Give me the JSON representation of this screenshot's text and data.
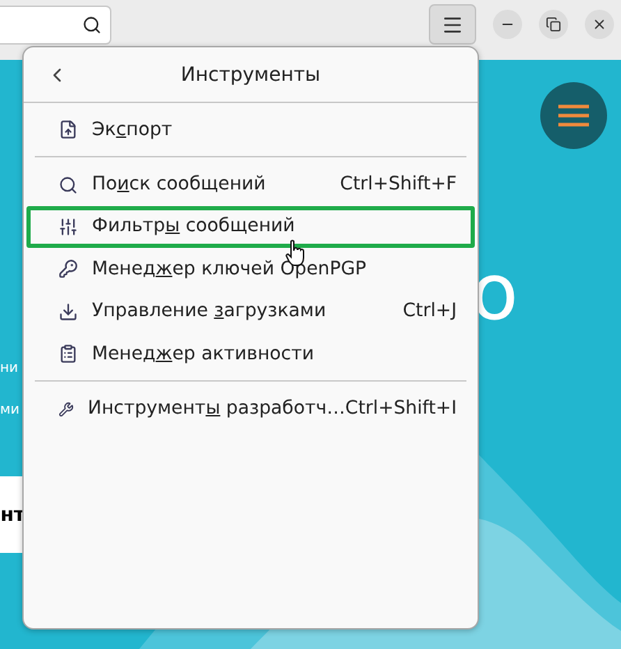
{
  "page": {
    "headline_right": "о",
    "line_1": "ни",
    "line_2": "ми",
    "button": "нт"
  },
  "menu": {
    "title": "Инструменты",
    "groups": [
      [
        {
          "label_parts": [
            "Эк",
            "с",
            "порт"
          ],
          "selected": false
        }
      ],
      [
        {
          "label_parts": [
            "По",
            "и",
            "ск сообщений"
          ],
          "shortcut": "Ctrl+Shift+F",
          "selected": false
        },
        {
          "label_parts": [
            "Фильтр",
            "ы",
            " сообщений"
          ],
          "selected": true
        },
        {
          "label_parts": [
            "Менед",
            "ж",
            "ер ключей OpenPGP"
          ],
          "selected": false
        },
        {
          "label_parts": [
            "Управление ",
            "з",
            "агрузками"
          ],
          "shortcut": "Ctrl+J",
          "selected": false
        },
        {
          "label_parts": [
            "Менед",
            "ж",
            "ер активности"
          ],
          "selected": false
        }
      ],
      [
        {
          "label_parts": [
            "Инструмент",
            "ы",
            " разработч…"
          ],
          "shortcut": "Ctrl+Shift+I",
          "selected": false
        }
      ]
    ]
  }
}
